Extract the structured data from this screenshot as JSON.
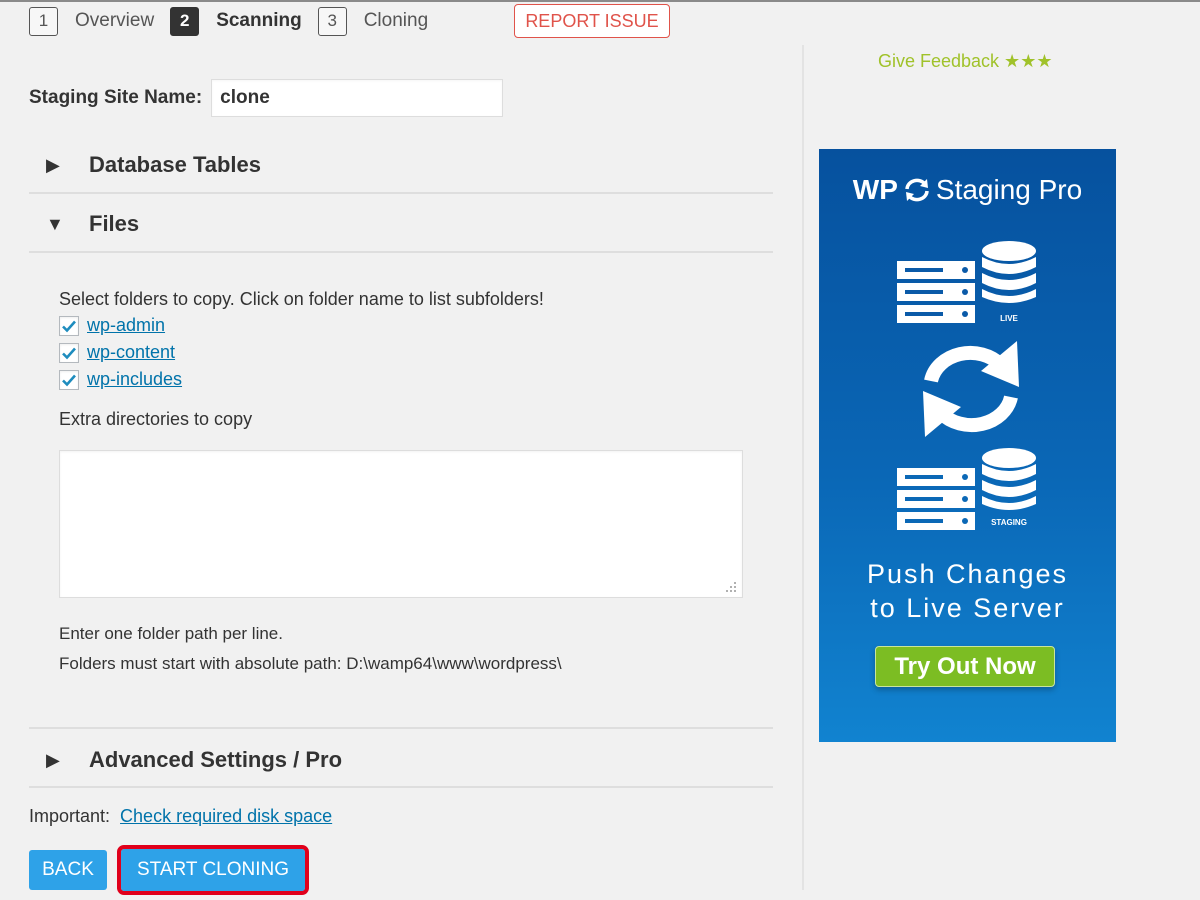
{
  "stepper": {
    "steps": [
      {
        "number": "1",
        "label": "Overview",
        "active": false
      },
      {
        "number": "2",
        "label": "Scanning",
        "active": true
      },
      {
        "number": "3",
        "label": "Cloning",
        "active": false
      }
    ],
    "report_issue_label": "REPORT ISSUE"
  },
  "site_name": {
    "label": "Staging Site Name:",
    "value": "clone"
  },
  "sections": {
    "database_tables": {
      "title": "Database Tables",
      "expanded": false
    },
    "files": {
      "title": "Files",
      "expanded": true
    },
    "advanced": {
      "title": "Advanced Settings / Pro",
      "expanded": false
    }
  },
  "files": {
    "hint": "Select folders to copy. Click on folder name to list subfolders!",
    "folders": [
      {
        "name": "wp-admin",
        "checked": true
      },
      {
        "name": "wp-content",
        "checked": true
      },
      {
        "name": "wp-includes",
        "checked": true
      }
    ],
    "extra_label": "Extra directories to copy",
    "extra_value": "",
    "help_line1": "Enter one folder path per line.",
    "help_line2": "Folders must start with absolute path: D:\\wamp64\\www\\wordpress\\"
  },
  "important": {
    "label": "Important:",
    "link": "Check required disk space"
  },
  "buttons": {
    "back": "BACK",
    "start": "START CLONING"
  },
  "sidebar": {
    "feedback": "Give Feedback ★★★",
    "banner": {
      "title_left": "WP",
      "title_right": "Staging Pro",
      "live_label": "LIVE",
      "staging_label": "STAGING",
      "line1": "Push Changes",
      "line2": "to Live Server",
      "cta": "Try Out Now"
    }
  },
  "colors": {
    "accent_blue": "#2ea2e8",
    "link": "#0073aa",
    "report_red": "#e0534a",
    "feedback_green": "#a0c22a",
    "cta_green": "#7cbd23",
    "banner_blue": "#0a67b6"
  }
}
